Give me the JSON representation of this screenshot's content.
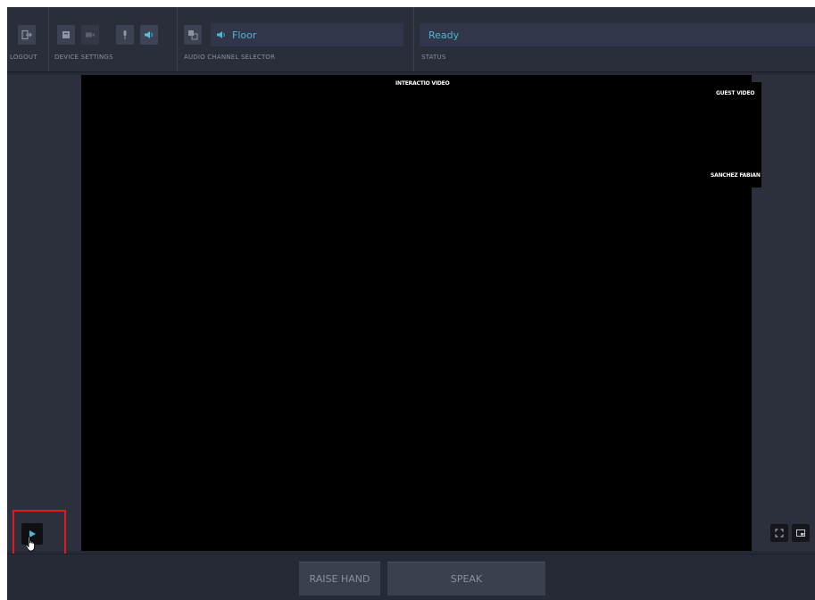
{
  "toolbar": {
    "logout_label": "LOGOUT",
    "device_settings_label": "DEVICE SETTINGS",
    "audio_channel_label": "AUDIO CHANNEL SELECTOR",
    "status_label": "STATUS",
    "audio_channel_value": "Floor",
    "status_value": "Ready"
  },
  "video": {
    "main_label": "INTERACTIO VIDEO",
    "guest_label": "GUEST VIDEO",
    "participant_name": "SANCHEZ FABIAN"
  },
  "actions": {
    "raise_hand_label": "RAISE HAND",
    "speak_label": "SPEAK"
  },
  "icons": {
    "logout": "logout-icon",
    "device_settings": "device-settings-icon",
    "camera": "camera-icon",
    "microphone": "microphone-icon",
    "speaker": "speaker-icon",
    "language": "language-icon",
    "play": "play-icon",
    "fullscreen": "fullscreen-icon",
    "picture_in_picture": "picture-in-picture-icon",
    "cursor": "hand-cursor-icon"
  },
  "colors": {
    "accent": "#4fb6d0",
    "background": "#262a36",
    "highlight": "#e01b1b"
  }
}
